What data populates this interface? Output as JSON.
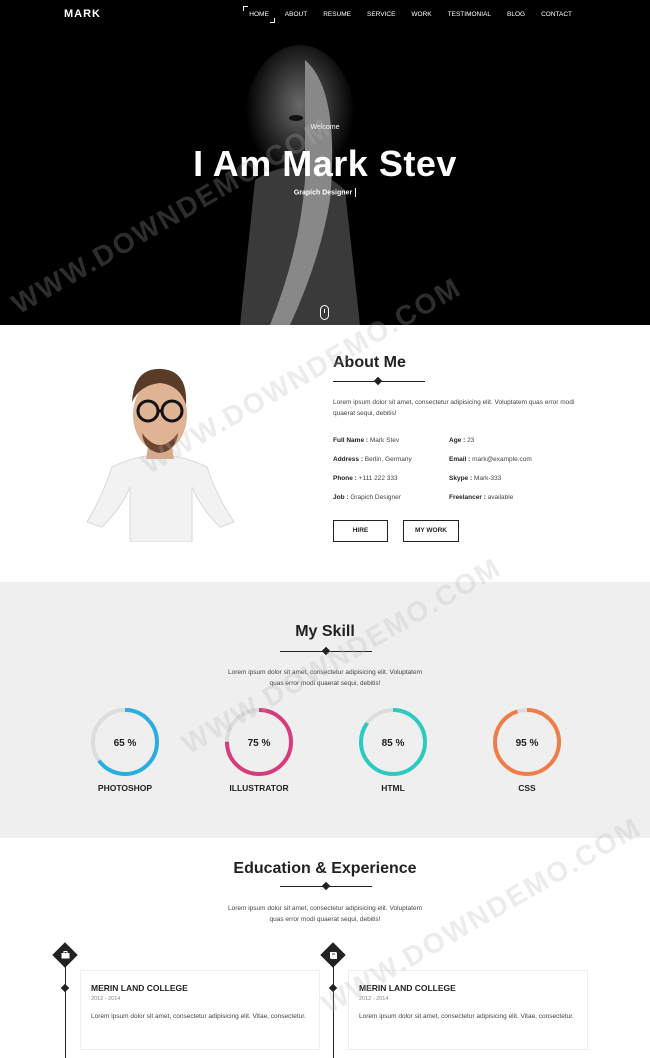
{
  "nav": {
    "brand": "MARK",
    "items": [
      {
        "label": "HOME",
        "active": true
      },
      {
        "label": "ABOUT"
      },
      {
        "label": "RESUME"
      },
      {
        "label": "SERVICE"
      },
      {
        "label": "WORK"
      },
      {
        "label": "TESTIMONIAL"
      },
      {
        "label": "BLOG"
      },
      {
        "label": "CONTACT"
      }
    ]
  },
  "hero": {
    "welcome": "Welcome",
    "title": "I Am Mark Stev",
    "subtitle": "Grapich Designer",
    "scroll_icon": "mouse-icon"
  },
  "about": {
    "title": "About Me",
    "description": "Lorem ipsum dolor sit amet, consectetur adipisicing elit. Voluptatem quas error modi quaerat sequi, debitis!",
    "info_left": [
      {
        "label": "Full Name :",
        "value": "Mark Stev"
      },
      {
        "label": "Address :",
        "value": "Berlin, Germany"
      },
      {
        "label": "Phone :",
        "value": "+111 222 333"
      },
      {
        "label": "Job :",
        "value": "Grapich Designer"
      }
    ],
    "info_right": [
      {
        "label": "Age :",
        "value": "23"
      },
      {
        "label": "Email :",
        "value": "mark@example.com"
      },
      {
        "label": "Skype :",
        "value": "Mark-333"
      },
      {
        "label": "Freelancer :",
        "value": "available"
      }
    ],
    "hire_label": "HIRE",
    "work_label": "MY WORK"
  },
  "skill": {
    "title": "My Skill",
    "description_line1": "Lorem ipsum dolor sit amet, consectetur adipisicing elit. Voluptatem",
    "description_line2": "quas error modi quaerat sequi, debitis!",
    "items": [
      {
        "name": "PHOTOSHOP",
        "percent": 65,
        "label": "65 %",
        "color": "#29aee0"
      },
      {
        "name": "ILLUSTRATOR",
        "percent": 75,
        "label": "75 %",
        "color": "#d63c7c"
      },
      {
        "name": "HTML",
        "percent": 85,
        "label": "85 %",
        "color": "#2ec9c0"
      },
      {
        "name": "CSS",
        "percent": 95,
        "label": "95 %",
        "color": "#ef7d4a"
      }
    ],
    "track_color": "#dddddd"
  },
  "education": {
    "title": "Education & Experience",
    "description_line1": "Lorem ipsum dolor sit amet, consectetur adipisicing elit. Voluptatem",
    "description_line2": "quas error modi quaerat sequi, debitis!",
    "columns": [
      {
        "icon": "briefcase-icon",
        "title": "MERIN LAND COLLEGE",
        "date": "2012 - 2014",
        "desc": "Lorem ipsum dolor sit amet, consectetur adipisicing elit. Vitae, consectetur."
      },
      {
        "icon": "book-icon",
        "title": "MERIN LAND COLLEGE",
        "date": "2012 - 2014",
        "desc": "Lorem ipsum dolor sit amet, consectetur adipisicing elit. Vitae, consectetur."
      }
    ]
  },
  "watermark": "WWW.DOWNDEMO.COM"
}
